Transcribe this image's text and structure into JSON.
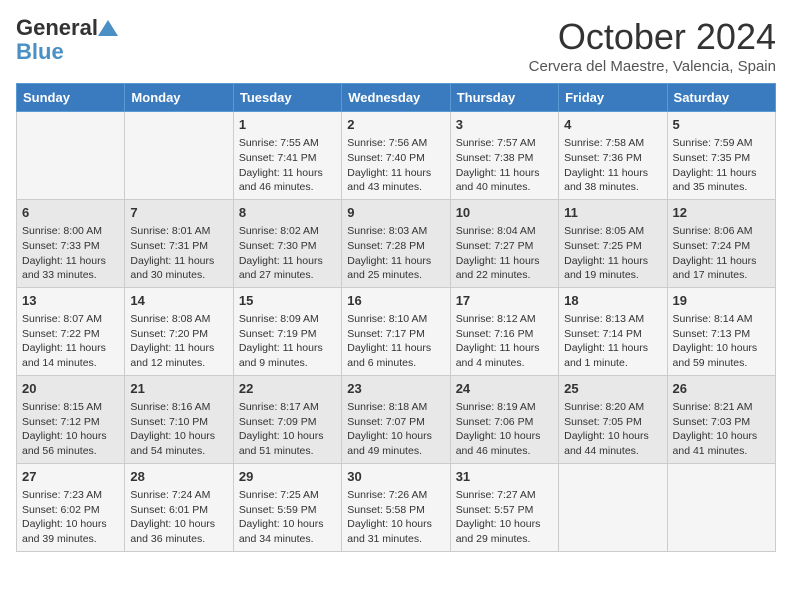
{
  "logo": {
    "line1": "General",
    "line2": "Blue"
  },
  "title": "October 2024",
  "subtitle": "Cervera del Maestre, Valencia, Spain",
  "days_of_week": [
    "Sunday",
    "Monday",
    "Tuesday",
    "Wednesday",
    "Thursday",
    "Friday",
    "Saturday"
  ],
  "weeks": [
    [
      {
        "day": "",
        "info": ""
      },
      {
        "day": "",
        "info": ""
      },
      {
        "day": "1",
        "info": "Sunrise: 7:55 AM\nSunset: 7:41 PM\nDaylight: 11 hours and 46 minutes."
      },
      {
        "day": "2",
        "info": "Sunrise: 7:56 AM\nSunset: 7:40 PM\nDaylight: 11 hours and 43 minutes."
      },
      {
        "day": "3",
        "info": "Sunrise: 7:57 AM\nSunset: 7:38 PM\nDaylight: 11 hours and 40 minutes."
      },
      {
        "day": "4",
        "info": "Sunrise: 7:58 AM\nSunset: 7:36 PM\nDaylight: 11 hours and 38 minutes."
      },
      {
        "day": "5",
        "info": "Sunrise: 7:59 AM\nSunset: 7:35 PM\nDaylight: 11 hours and 35 minutes."
      }
    ],
    [
      {
        "day": "6",
        "info": "Sunrise: 8:00 AM\nSunset: 7:33 PM\nDaylight: 11 hours and 33 minutes."
      },
      {
        "day": "7",
        "info": "Sunrise: 8:01 AM\nSunset: 7:31 PM\nDaylight: 11 hours and 30 minutes."
      },
      {
        "day": "8",
        "info": "Sunrise: 8:02 AM\nSunset: 7:30 PM\nDaylight: 11 hours and 27 minutes."
      },
      {
        "day": "9",
        "info": "Sunrise: 8:03 AM\nSunset: 7:28 PM\nDaylight: 11 hours and 25 minutes."
      },
      {
        "day": "10",
        "info": "Sunrise: 8:04 AM\nSunset: 7:27 PM\nDaylight: 11 hours and 22 minutes."
      },
      {
        "day": "11",
        "info": "Sunrise: 8:05 AM\nSunset: 7:25 PM\nDaylight: 11 hours and 19 minutes."
      },
      {
        "day": "12",
        "info": "Sunrise: 8:06 AM\nSunset: 7:24 PM\nDaylight: 11 hours and 17 minutes."
      }
    ],
    [
      {
        "day": "13",
        "info": "Sunrise: 8:07 AM\nSunset: 7:22 PM\nDaylight: 11 hours and 14 minutes."
      },
      {
        "day": "14",
        "info": "Sunrise: 8:08 AM\nSunset: 7:20 PM\nDaylight: 11 hours and 12 minutes."
      },
      {
        "day": "15",
        "info": "Sunrise: 8:09 AM\nSunset: 7:19 PM\nDaylight: 11 hours and 9 minutes."
      },
      {
        "day": "16",
        "info": "Sunrise: 8:10 AM\nSunset: 7:17 PM\nDaylight: 11 hours and 6 minutes."
      },
      {
        "day": "17",
        "info": "Sunrise: 8:12 AM\nSunset: 7:16 PM\nDaylight: 11 hours and 4 minutes."
      },
      {
        "day": "18",
        "info": "Sunrise: 8:13 AM\nSunset: 7:14 PM\nDaylight: 11 hours and 1 minute."
      },
      {
        "day": "19",
        "info": "Sunrise: 8:14 AM\nSunset: 7:13 PM\nDaylight: 10 hours and 59 minutes."
      }
    ],
    [
      {
        "day": "20",
        "info": "Sunrise: 8:15 AM\nSunset: 7:12 PM\nDaylight: 10 hours and 56 minutes."
      },
      {
        "day": "21",
        "info": "Sunrise: 8:16 AM\nSunset: 7:10 PM\nDaylight: 10 hours and 54 minutes."
      },
      {
        "day": "22",
        "info": "Sunrise: 8:17 AM\nSunset: 7:09 PM\nDaylight: 10 hours and 51 minutes."
      },
      {
        "day": "23",
        "info": "Sunrise: 8:18 AM\nSunset: 7:07 PM\nDaylight: 10 hours and 49 minutes."
      },
      {
        "day": "24",
        "info": "Sunrise: 8:19 AM\nSunset: 7:06 PM\nDaylight: 10 hours and 46 minutes."
      },
      {
        "day": "25",
        "info": "Sunrise: 8:20 AM\nSunset: 7:05 PM\nDaylight: 10 hours and 44 minutes."
      },
      {
        "day": "26",
        "info": "Sunrise: 8:21 AM\nSunset: 7:03 PM\nDaylight: 10 hours and 41 minutes."
      }
    ],
    [
      {
        "day": "27",
        "info": "Sunrise: 7:23 AM\nSunset: 6:02 PM\nDaylight: 10 hours and 39 minutes."
      },
      {
        "day": "28",
        "info": "Sunrise: 7:24 AM\nSunset: 6:01 PM\nDaylight: 10 hours and 36 minutes."
      },
      {
        "day": "29",
        "info": "Sunrise: 7:25 AM\nSunset: 5:59 PM\nDaylight: 10 hours and 34 minutes."
      },
      {
        "day": "30",
        "info": "Sunrise: 7:26 AM\nSunset: 5:58 PM\nDaylight: 10 hours and 31 minutes."
      },
      {
        "day": "31",
        "info": "Sunrise: 7:27 AM\nSunset: 5:57 PM\nDaylight: 10 hours and 29 minutes."
      },
      {
        "day": "",
        "info": ""
      },
      {
        "day": "",
        "info": ""
      }
    ]
  ]
}
